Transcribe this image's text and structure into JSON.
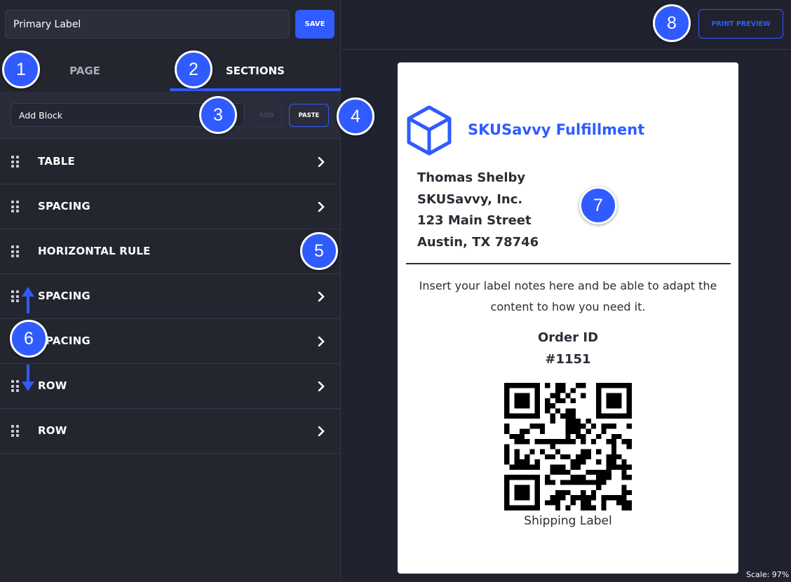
{
  "header": {
    "template_name_value": "Primary Label",
    "save_label": "SAVE"
  },
  "tabs": [
    {
      "label": "PAGE",
      "active": false
    },
    {
      "label": "SECTIONS",
      "active": true
    }
  ],
  "add_bar": {
    "block_select_value": "Add Block",
    "add_label": "ADD",
    "paste_label": "PASTE"
  },
  "sections": [
    {
      "label": "TABLE",
      "has_chevron": true
    },
    {
      "label": "SPACING",
      "has_chevron": true
    },
    {
      "label": "HORIZONTAL RULE",
      "has_chevron": false
    },
    {
      "label": "SPACING",
      "has_chevron": true
    },
    {
      "label": "SPACING",
      "has_chevron": true
    },
    {
      "label": "ROW",
      "has_chevron": true
    },
    {
      "label": "ROW",
      "has_chevron": true
    }
  ],
  "toolbar": {
    "print_preview_label": "PRINT PREVIEW"
  },
  "label_preview": {
    "brand_icon": "cube-icon",
    "brand_name": "SKUSavvy Fulfillment",
    "address": [
      "Thomas Shelby",
      "SKUSavvy, Inc.",
      "123 Main Street",
      "Austin, TX 78746"
    ],
    "notes": "Insert your label notes here and be able to adapt the content to how you need it.",
    "order_title": "Order ID",
    "order_number": "#1151",
    "qr_caption": "Shipping Label"
  },
  "status": {
    "scale_text": "Scale: 97%"
  },
  "annotations": [
    "1",
    "2",
    "3",
    "4",
    "5",
    "6",
    "7",
    "8"
  ],
  "colors": {
    "accent": "#2f5bff",
    "panel": "#23252f",
    "background": "#202230",
    "label_text": "#2b2d35"
  }
}
